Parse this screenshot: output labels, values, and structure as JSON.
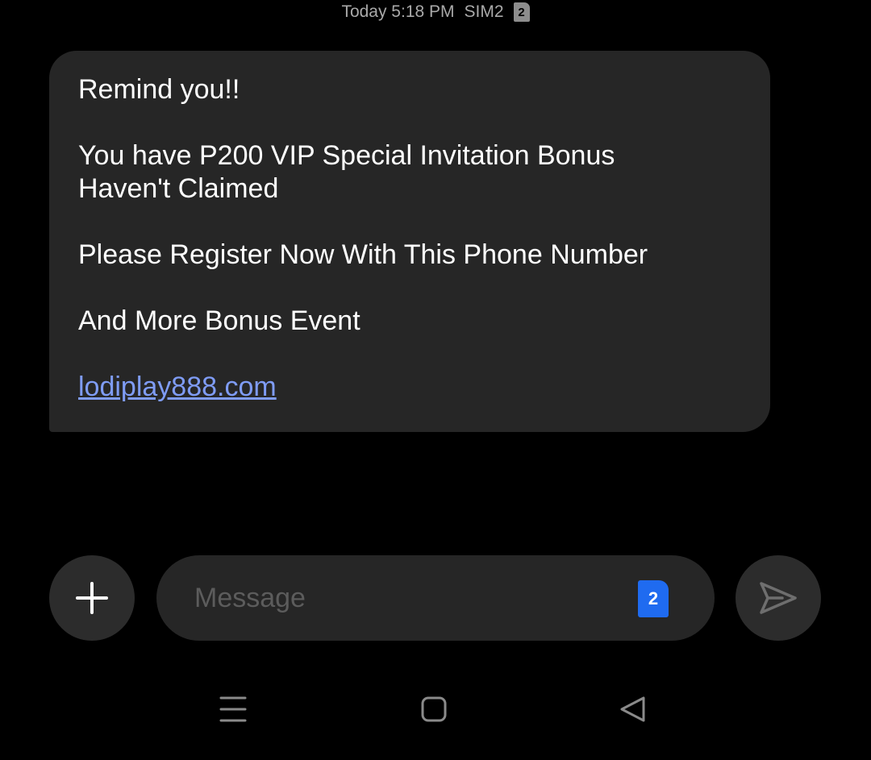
{
  "header": {
    "date_time": "Today 5:18 PM",
    "sim_label": "SIM2",
    "sim_number": "2"
  },
  "message": {
    "line1": "Remind you!!",
    "line2": "You have P200 VIP Special Invitation Bonus",
    "line3": "Haven't Claimed",
    "line4": "Please Register Now With This Phone Number",
    "line5": "And More Bonus Event",
    "link": "lodiplay888.com"
  },
  "composer": {
    "placeholder": "Message",
    "sim_selector": "2"
  },
  "icons": {
    "add": "plus-icon",
    "send": "send-icon",
    "nav_menu": "menu-icon",
    "nav_home": "home-icon",
    "nav_back": "back-icon"
  },
  "colors": {
    "background": "#000000",
    "bubble": "#262626",
    "link": "#7f9cf5",
    "sim_accent": "#1f6bf0"
  }
}
